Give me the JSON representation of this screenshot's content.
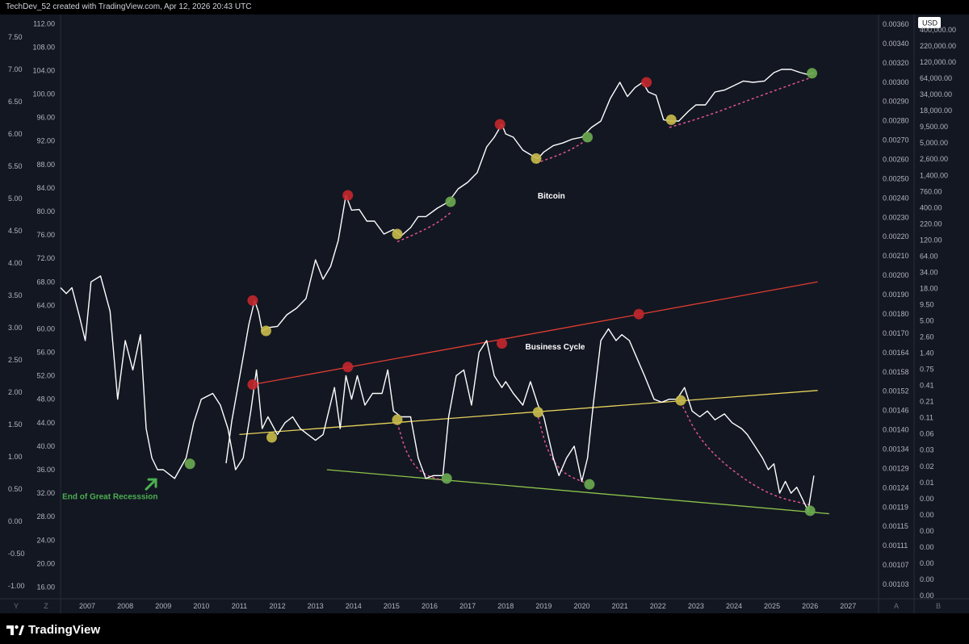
{
  "header": {
    "credit": "TechDev_52 created with TradingView.com, Apr 12, 2026 20:43 UTC"
  },
  "footer": {
    "logo_text": "TradingView"
  },
  "colors": {
    "background": "#131722",
    "line": "#ffffff",
    "red": "#c0272d",
    "yellow": "#c5b84a",
    "green": "#6aa84f",
    "red_trend": "#e03c31",
    "yellow_trend": "#e6d25a",
    "green_trend": "#8bc34a",
    "dashed": "#e0548e",
    "annotation_green": "#4caf50"
  },
  "chart_data": {
    "type": "line",
    "title": "",
    "x_axis": {
      "ticks": [
        "2007",
        "2008",
        "2009",
        "2010",
        "2011",
        "2012",
        "2013",
        "2014",
        "2015",
        "2016",
        "2017",
        "2018",
        "2019",
        "2020",
        "2021",
        "2022",
        "2023",
        "2024",
        "2025",
        "2026",
        "2027"
      ],
      "range": [
        2006.3,
        2027.8
      ]
    },
    "left_axis_outer": {
      "labels": [
        "7.50",
        "7.00",
        "6.50",
        "6.00",
        "5.50",
        "5.00",
        "4.50",
        "4.00",
        "3.50",
        "3.00",
        "2.50",
        "2.00",
        "1.50",
        "1.00",
        "0.50",
        "0.00",
        "-0.50",
        "-1.00"
      ],
      "range": [
        -1.2,
        7.8
      ]
    },
    "left_axis_inner": {
      "labels": [
        "112.00",
        "108.00",
        "104.00",
        "100.00",
        "96.00",
        "92.00",
        "88.00",
        "84.00",
        "80.00",
        "76.00",
        "72.00",
        "68.00",
        "64.00",
        "60.00",
        "56.00",
        "52.00",
        "48.00",
        "44.00",
        "40.00",
        "36.00",
        "32.00",
        "28.00",
        "24.00",
        "20.00",
        "16.00"
      ],
      "range": [
        14,
        113
      ]
    },
    "right_axis_inner": {
      "labels": [
        "0.00360",
        "0.00340",
        "0.00320",
        "0.00300",
        "0.00290",
        "0.00280",
        "0.00270",
        "0.00260",
        "0.00250",
        "0.00240",
        "0.00230",
        "0.00220",
        "0.00210",
        "0.00200",
        "0.00190",
        "0.00180",
        "0.00170",
        "0.00164",
        "0.00158",
        "0.00152",
        "0.00146",
        "0.00140",
        "0.00134",
        "0.00129",
        "0.00124",
        "0.00119",
        "0.00115",
        "0.00111",
        "0.00107",
        "0.00103"
      ]
    },
    "right_axis_outer": {
      "unit_label": "USD",
      "labels": [
        "400,000.00",
        "220,000.00",
        "120,000.00",
        "64,000.00",
        "34,000.00",
        "18,000.00",
        "9,500.00",
        "5,000.00",
        "2,600.00",
        "1,400.00",
        "760.00",
        "400.00",
        "220.00",
        "120.00",
        "64.00",
        "34.00",
        "18.00",
        "9.50",
        "5.00",
        "2.60",
        "1.40",
        "0.75",
        "0.41",
        "0.21",
        "0.11",
        "0.06",
        "0.03",
        "0.02",
        "0.01",
        "0.00",
        "0.00",
        "0.00",
        "0.00",
        "0.00",
        "0.00",
        "0.00"
      ]
    },
    "bottom_axis_buttons": {
      "left": [
        "Y",
        "Z"
      ],
      "right": [
        "A",
        "B"
      ]
    },
    "series": [
      {
        "name": "Bitcoin",
        "axis": "left_axis_outer",
        "x": [
          2010.65,
          2010.8,
          2010.95,
          2011.1,
          2011.25,
          2011.4,
          2011.5,
          2011.6,
          2011.75,
          2012.0,
          2012.25,
          2012.5,
          2012.75,
          2013.0,
          2013.2,
          2013.4,
          2013.6,
          2013.8,
          2013.95,
          2014.15,
          2014.35,
          2014.55,
          2014.8,
          2015.05,
          2015.25,
          2015.5,
          2015.7,
          2015.9,
          2016.2,
          2016.5,
          2016.75,
          2017.0,
          2017.25,
          2017.5,
          2017.7,
          2017.9,
          2018.0,
          2018.2,
          2018.45,
          2018.65,
          2018.85,
          2019.0,
          2019.25,
          2019.5,
          2019.75,
          2020.0,
          2020.25,
          2020.5,
          2020.75,
          2021.0,
          2021.2,
          2021.4,
          2021.6,
          2021.75,
          2021.95,
          2022.15,
          2022.35,
          2022.55,
          2022.8,
          2023.0,
          2023.25,
          2023.5,
          2023.75,
          2024.0,
          2024.25,
          2024.5,
          2024.8,
          2025.05,
          2025.25,
          2025.5,
          2025.75,
          2025.95,
          2026.1
        ],
        "y": [
          0.9,
          1.55,
          2.05,
          2.55,
          3.05,
          3.42,
          3.25,
          2.95,
          3.0,
          3.02,
          3.2,
          3.3,
          3.45,
          4.05,
          3.75,
          3.95,
          4.35,
          5.05,
          4.82,
          4.83,
          4.65,
          4.65,
          4.45,
          4.52,
          4.42,
          4.55,
          4.72,
          4.72,
          4.85,
          4.95,
          5.15,
          5.25,
          5.4,
          5.8,
          5.95,
          6.15,
          6.0,
          5.95,
          5.75,
          5.68,
          5.62,
          5.72,
          5.82,
          5.86,
          5.92,
          5.95,
          6.1,
          6.2,
          6.55,
          6.8,
          6.58,
          6.72,
          6.8,
          6.65,
          6.6,
          6.22,
          6.2,
          6.2,
          6.35,
          6.45,
          6.45,
          6.65,
          6.68,
          6.75,
          6.82,
          6.8,
          6.82,
          6.95,
          7.0,
          7.0,
          6.95,
          6.92,
          6.95
        ]
      },
      {
        "name": "Business Cycle",
        "axis": "left_axis_inner",
        "x": [
          2006.3,
          2006.45,
          2006.6,
          2006.8,
          2006.95,
          2007.1,
          2007.35,
          2007.6,
          2007.8,
          2008.0,
          2008.2,
          2008.4,
          2008.55,
          2008.7,
          2008.85,
          2009.0,
          2009.3,
          2009.6,
          2009.8,
          2010.0,
          2010.3,
          2010.5,
          2010.7,
          2010.9,
          2011.1,
          2011.3,
          2011.45,
          2011.6,
          2011.75,
          2012.0,
          2012.2,
          2012.4,
          2012.6,
          2012.8,
          2013.0,
          2013.2,
          2013.5,
          2013.65,
          2013.8,
          2013.95,
          2014.1,
          2014.3,
          2014.5,
          2014.75,
          2014.9,
          2015.05,
          2015.25,
          2015.5,
          2015.7,
          2015.9,
          2016.1,
          2016.35,
          2016.5,
          2016.7,
          2016.9,
          2017.1,
          2017.3,
          2017.5,
          2017.7,
          2017.9,
          2018.0,
          2018.2,
          2018.45,
          2018.65,
          2018.85,
          2019.0,
          2019.25,
          2019.4,
          2019.6,
          2019.8,
          2020.0,
          2020.15,
          2020.3,
          2020.5,
          2020.7,
          2020.9,
          2021.05,
          2021.25,
          2021.45,
          2021.65,
          2021.9,
          2022.1,
          2022.3,
          2022.5,
          2022.7,
          2022.9,
          2023.1,
          2023.3,
          2023.5,
          2023.75,
          2023.95,
          2024.2,
          2024.35,
          2024.55,
          2024.75,
          2024.9,
          2025.05,
          2025.2,
          2025.35,
          2025.5,
          2025.65,
          2025.8,
          2025.95,
          2026.1
        ],
        "y": [
          67,
          66,
          67,
          62,
          58,
          68,
          69,
          63,
          48,
          58,
          53,
          59,
          43,
          38,
          36,
          36,
          34.5,
          38,
          44,
          48,
          49,
          47,
          43,
          36,
          38,
          46,
          53,
          43,
          45,
          42,
          44,
          45,
          43,
          42,
          41,
          42,
          50,
          43,
          52,
          48,
          52,
          47,
          49,
          49,
          53,
          46,
          45,
          45,
          38,
          34.5,
          35,
          35,
          45,
          52,
          53,
          47,
          56,
          58,
          52,
          50,
          51,
          49,
          47,
          51,
          47,
          45,
          38,
          35,
          38,
          40,
          34,
          38,
          47,
          58,
          60,
          58,
          59,
          58,
          55,
          52,
          48,
          47.5,
          48,
          48,
          50,
          46,
          45,
          46,
          44.5,
          45.5,
          44,
          43,
          42,
          40,
          38,
          36,
          37,
          32,
          34,
          32,
          33,
          31,
          29,
          35
        ]
      }
    ],
    "markers": [
      {
        "color": "red",
        "x": 2011.35,
        "y": 3.42,
        "axis": "left_axis_outer"
      },
      {
        "color": "yellow",
        "x": 2011.7,
        "y": 2.95,
        "axis": "left_axis_outer"
      },
      {
        "color": "red",
        "x": 2013.85,
        "y": 5.05,
        "axis": "left_axis_outer"
      },
      {
        "color": "yellow",
        "x": 2015.15,
        "y": 4.45,
        "axis": "left_axis_outer"
      },
      {
        "color": "green",
        "x": 2016.55,
        "y": 4.95,
        "axis": "left_axis_outer"
      },
      {
        "color": "red",
        "x": 2017.85,
        "y": 6.15,
        "axis": "left_axis_outer"
      },
      {
        "color": "yellow",
        "x": 2018.8,
        "y": 5.62,
        "axis": "left_axis_outer"
      },
      {
        "color": "green",
        "x": 2020.15,
        "y": 5.95,
        "axis": "left_axis_outer"
      },
      {
        "color": "red",
        "x": 2021.7,
        "y": 6.8,
        "axis": "left_axis_outer"
      },
      {
        "color": "yellow",
        "x": 2022.35,
        "y": 6.22,
        "axis": "left_axis_outer"
      },
      {
        "color": "green",
        "x": 2026.05,
        "y": 6.94,
        "axis": "left_axis_outer"
      },
      {
        "color": "green",
        "x": 2009.7,
        "y": 37,
        "axis": "left_axis_inner"
      },
      {
        "color": "red",
        "x": 2011.35,
        "y": 50.5,
        "axis": "left_axis_inner"
      },
      {
        "color": "yellow",
        "x": 2011.85,
        "y": 41.5,
        "axis": "left_axis_inner"
      },
      {
        "color": "red",
        "x": 2013.85,
        "y": 53.5,
        "axis": "left_axis_inner"
      },
      {
        "color": "yellow",
        "x": 2015.15,
        "y": 44.5,
        "axis": "left_axis_inner"
      },
      {
        "color": "green",
        "x": 2016.45,
        "y": 34.5,
        "axis": "left_axis_inner"
      },
      {
        "color": "red",
        "x": 2017.9,
        "y": 57.5,
        "axis": "left_axis_inner"
      },
      {
        "color": "yellow",
        "x": 2018.85,
        "y": 45.8,
        "axis": "left_axis_inner"
      },
      {
        "color": "green",
        "x": 2020.2,
        "y": 33.5,
        "axis": "left_axis_inner"
      },
      {
        "color": "red",
        "x": 2021.5,
        "y": 62.5,
        "axis": "left_axis_inner"
      },
      {
        "color": "yellow",
        "x": 2022.6,
        "y": 47.8,
        "axis": "left_axis_inner"
      },
      {
        "color": "green",
        "x": 2026.0,
        "y": 29,
        "axis": "left_axis_inner"
      }
    ],
    "trendlines": [
      {
        "color": "red",
        "axis": "left_axis_inner",
        "from": [
          2011.35,
          50.5
        ],
        "to": [
          2026.2,
          68
        ]
      },
      {
        "color": "yellow",
        "axis": "left_axis_inner",
        "from": [
          2011.0,
          42
        ],
        "to": [
          2026.2,
          49.5
        ]
      },
      {
        "color": "green",
        "axis": "left_axis_inner",
        "from": [
          2013.3,
          36
        ],
        "to": [
          2026.5,
          28.5
        ]
      }
    ],
    "dashed_curves": [
      {
        "axis": "left_axis_outer",
        "points": [
          [
            2015.15,
            4.33
          ],
          [
            2015.7,
            4.47
          ],
          [
            2016.2,
            4.62
          ],
          [
            2016.55,
            4.78
          ]
        ]
      },
      {
        "axis": "left_axis_outer",
        "points": [
          [
            2018.8,
            5.55
          ],
          [
            2019.3,
            5.65
          ],
          [
            2019.8,
            5.78
          ],
          [
            2020.15,
            5.92
          ]
        ]
      },
      {
        "axis": "left_axis_outer",
        "points": [
          [
            2022.3,
            6.1
          ],
          [
            2023.3,
            6.28
          ],
          [
            2024.5,
            6.55
          ],
          [
            2026.05,
            6.88
          ]
        ]
      },
      {
        "axis": "left_axis_inner",
        "points": [
          [
            2015.15,
            44
          ],
          [
            2015.4,
            38.5
          ],
          [
            2015.8,
            35.2
          ],
          [
            2016.45,
            34
          ]
        ]
      },
      {
        "axis": "left_axis_inner",
        "points": [
          [
            2018.85,
            45
          ],
          [
            2019.1,
            39
          ],
          [
            2019.5,
            35.3
          ],
          [
            2020.2,
            33.5
          ]
        ]
      },
      {
        "axis": "left_axis_inner",
        "points": [
          [
            2022.6,
            47.5
          ],
          [
            2023.1,
            41
          ],
          [
            2024.0,
            35.5
          ],
          [
            2025.0,
            31.5
          ],
          [
            2026.0,
            30
          ]
        ]
      }
    ],
    "annotations": [
      {
        "text": "Bitcoin",
        "x": 2019.2,
        "y": 5.0,
        "axis": "left_axis_outer",
        "color": "white"
      },
      {
        "text": "Business Cycle",
        "x": 2019.3,
        "y": 56.5,
        "axis": "left_axis_inner",
        "color": "white"
      },
      {
        "text": "End of Great Recesssion",
        "x": 2007.6,
        "y": 31,
        "axis": "left_axis_inner",
        "color": "green"
      }
    ]
  }
}
